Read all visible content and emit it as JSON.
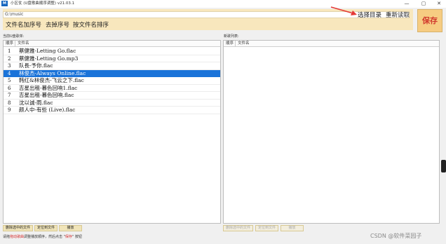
{
  "titlebar": {
    "title": "小区仗 (U盘歌曲顺序调整) v21.03.1",
    "minimize": "—",
    "maximize": "▢",
    "close": "✕"
  },
  "toolbar": {
    "path": "G:\\music",
    "btn_add_number": "文件名加序号",
    "btn_remove_number": "去掉序号",
    "btn_sort_by_name": "按文件名排序",
    "btn_choose_dir": "选择目录",
    "btn_reload": "重新读取",
    "btn_save": "保存"
  },
  "left": {
    "label": "当前U盘歌单:",
    "col_index": "顺序",
    "col_name": "文件名",
    "rows": [
      {
        "index": "1",
        "name": "蔡健雅-Letting Go.flac"
      },
      {
        "index": "2",
        "name": "蔡健雅-Letting Go.mp3"
      },
      {
        "index": "3",
        "name": "队長-予你.flac"
      },
      {
        "index": "4",
        "name": "林俊杰-Always Online.flac"
      },
      {
        "index": "5",
        "name": "韩红&林俊杰-飞云之下.flac"
      },
      {
        "index": "6",
        "name": "吉星出租-暮色回响1.flac"
      },
      {
        "index": "7",
        "name": "吉星出租-暮色回响.flac"
      },
      {
        "index": "8",
        "name": "沈以诚-雨.flac"
      },
      {
        "index": "9",
        "name": "颜人中-有些 (Live).flac"
      }
    ],
    "selected": "4",
    "btn_delete": "删除选中的文件",
    "btn_locate": "定位到文件",
    "btn_play": "播放"
  },
  "right": {
    "label": "新歌列表:",
    "col_index": "顺序",
    "col_name": "文件名",
    "btn_delete": "删除选中的文件",
    "btn_locate": "定位到文件",
    "btn_play": "播放"
  },
  "status": {
    "prefix": "请拖",
    "highlight": "拖动歌曲",
    "middle": "调整播放顺序，然后点击 \"",
    "save_word": "保存",
    "suffix": "\" 按钮"
  },
  "watermark": "CSDN @软件菜园子",
  "colors": {
    "toolbar_bg": "#f8e7bd",
    "save_text": "#d13b2e",
    "selection": "#1a73d9",
    "arrow": "#e53935"
  }
}
